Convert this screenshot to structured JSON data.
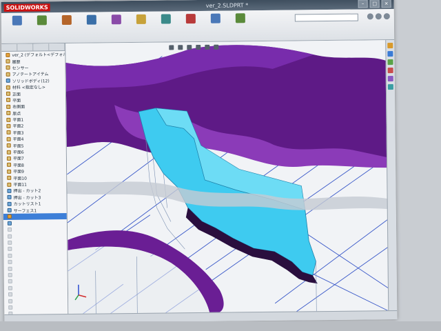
{
  "window": {
    "app_logo": "SOLIDWORKS",
    "document_title": "ver_2.SLDPRT *"
  },
  "ribbon": {
    "tools": [
      {
        "label": "",
        "color": "#4a78b8"
      },
      {
        "label": "",
        "color": "#5a8a3a"
      },
      {
        "label": "",
        "color": "#b5652a"
      },
      {
        "label": "",
        "color": "#3a6fa8"
      },
      {
        "label": "",
        "color": "#8a4ba8"
      },
      {
        "label": "",
        "color": "#c7a23a"
      },
      {
        "label": "",
        "color": "#3a8a8a"
      },
      {
        "label": "",
        "color": "#b83a3a"
      },
      {
        "label": "",
        "color": "#4a78b8"
      },
      {
        "label": "",
        "color": "#5a8a3a"
      }
    ],
    "search_placeholder": "",
    "command_tabs": [
      "",
      "",
      "",
      "",
      ""
    ]
  },
  "tree": {
    "rows": [
      {
        "label": "ver_2 (デフォルト<デフォルト>)",
        "kind": "part"
      },
      {
        "label": "履歴",
        "kind": "plane"
      },
      {
        "label": "センサー",
        "kind": "plane"
      },
      {
        "label": "アノテートアイテム",
        "kind": "plane"
      },
      {
        "label": "ソリッドボディ(12)",
        "kind": "feat"
      },
      {
        "label": "材料 <指定なし>",
        "kind": "plane"
      },
      {
        "label": "正面",
        "kind": "plane"
      },
      {
        "label": "平面",
        "kind": "plane"
      },
      {
        "label": "右側面",
        "kind": "plane"
      },
      {
        "label": "原点",
        "kind": "plane"
      },
      {
        "label": "平面1",
        "kind": "plane"
      },
      {
        "label": "平面2",
        "kind": "plane"
      },
      {
        "label": "平面3",
        "kind": "plane"
      },
      {
        "label": "平面4",
        "kind": "plane"
      },
      {
        "label": "平面5",
        "kind": "plane"
      },
      {
        "label": "平面6",
        "kind": "plane"
      },
      {
        "label": "平面7",
        "kind": "plane"
      },
      {
        "label": "平面8",
        "kind": "plane"
      },
      {
        "label": "平面9",
        "kind": "plane"
      },
      {
        "label": "平面10",
        "kind": "plane"
      },
      {
        "label": "平面11",
        "kind": "plane"
      },
      {
        "label": "押出 - カット2",
        "kind": "feat"
      },
      {
        "label": "押出 - カット3",
        "kind": "feat"
      },
      {
        "label": "カットリスト1",
        "kind": "feat"
      },
      {
        "label": "サーフェス1",
        "kind": "feat"
      },
      {
        "label": "",
        "kind": "sel"
      },
      {
        "label": "",
        "kind": "feat"
      },
      {
        "label": "",
        "kind": "dim"
      },
      {
        "label": "",
        "kind": "dim"
      },
      {
        "label": "",
        "kind": "dim"
      },
      {
        "label": "",
        "kind": "dim"
      },
      {
        "label": "",
        "kind": "dim"
      },
      {
        "label": "",
        "kind": "dim"
      },
      {
        "label": "",
        "kind": "dim"
      },
      {
        "label": "",
        "kind": "dim"
      },
      {
        "label": "",
        "kind": "dim"
      },
      {
        "label": "",
        "kind": "dim"
      },
      {
        "label": "",
        "kind": "dim"
      },
      {
        "label": "",
        "kind": "dim"
      },
      {
        "label": "",
        "kind": "dim"
      },
      {
        "label": "",
        "kind": "dim"
      }
    ]
  },
  "viewport": {
    "colors": {
      "surface_purple": "#6a1e94",
      "surface_purple_light": "#8b3bb8",
      "cyan_solid": "#3ecbf0",
      "section_lines": "#3857c8",
      "background": "#f1f3f6"
    }
  },
  "statusbar": {
    "tabs": [
      "",
      "",
      ""
    ],
    "text": ""
  },
  "taskpane": {
    "icons": [
      "#d99a2b",
      "#3a7bd5",
      "#5aa347",
      "#c94d4d",
      "#8a5ac2",
      "#3a9ea3"
    ]
  }
}
